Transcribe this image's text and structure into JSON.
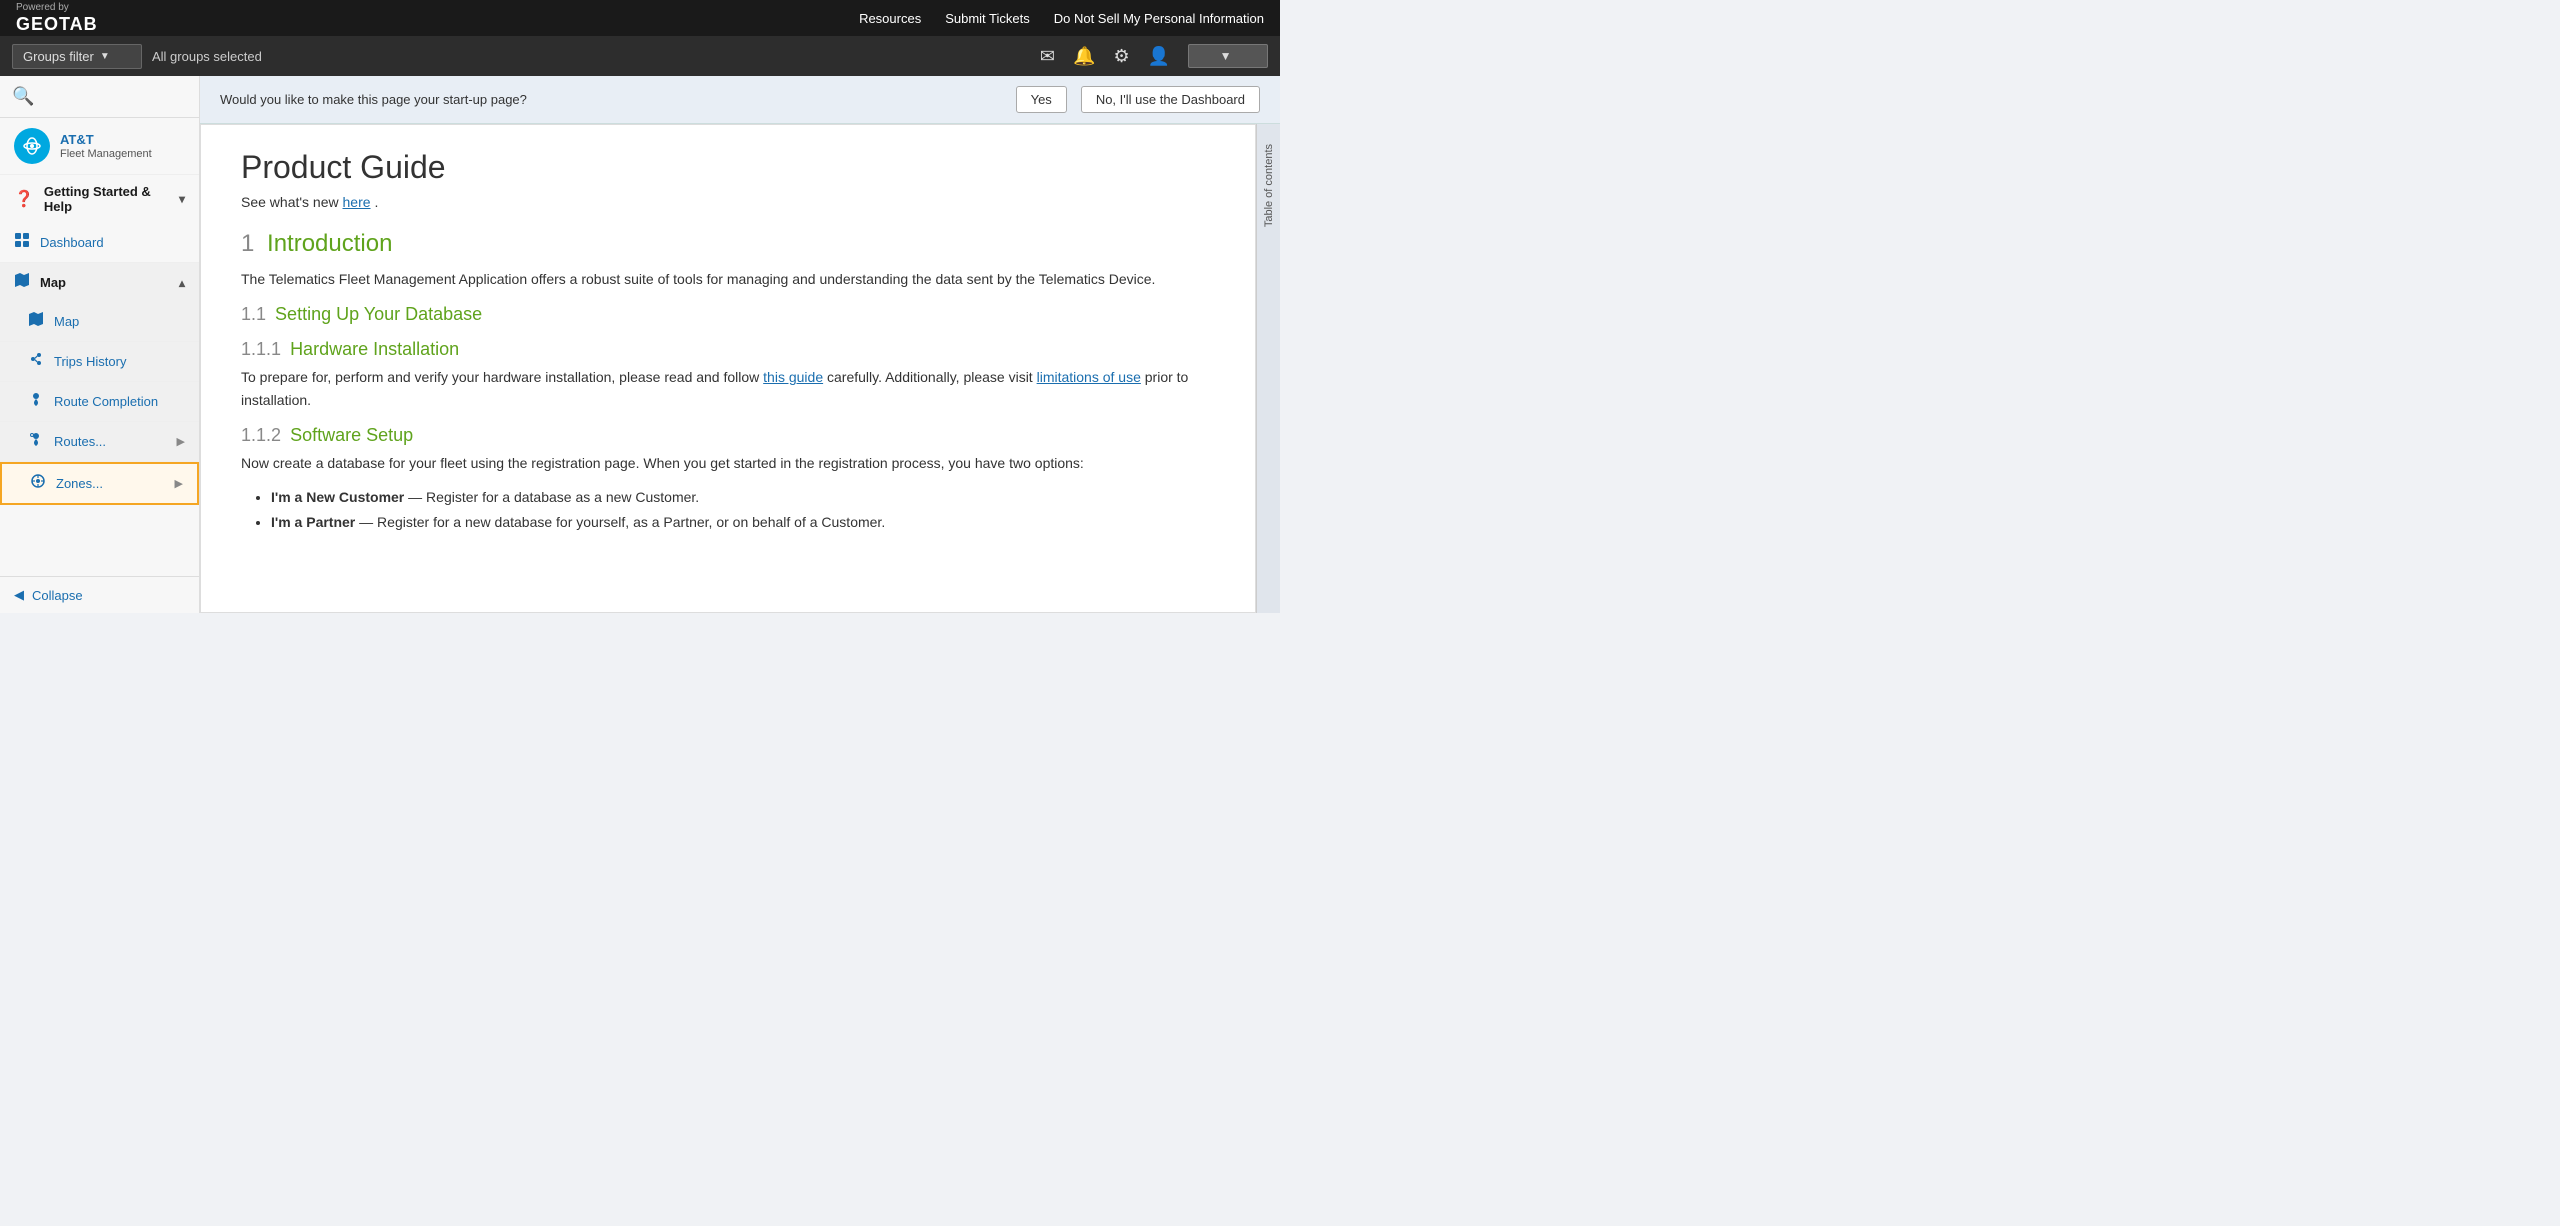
{
  "topBar": {
    "poweredBy": "Powered by",
    "brand": "GEOTAB",
    "links": [
      "Resources",
      "Submit Tickets",
      "Do Not Sell My Personal Information"
    ]
  },
  "filterBar": {
    "groupsFilterLabel": "Groups filter",
    "allGroupsSelected": "All groups selected",
    "icons": [
      "envelope-icon",
      "bell-icon",
      "gear-icon",
      "user-icon"
    ],
    "userDropdown": ""
  },
  "sidebar": {
    "searchIcon": "🔍",
    "org": {
      "logo": "AT&T",
      "name": "AT&T",
      "sub": "Fleet Management"
    },
    "gettingStarted": {
      "label": "Getting Started & Help",
      "expanded": true
    },
    "items": [
      {
        "icon": "📊",
        "label": "Dashboard",
        "active": false
      },
      {
        "icon": "🗺",
        "label": "Map",
        "expandable": true,
        "expanded": true
      },
      {
        "icon": "🗺",
        "label": "Map",
        "sub": true,
        "active": false
      },
      {
        "icon": "👣",
        "label": "Trips History",
        "sub": true,
        "active": false
      },
      {
        "icon": "📍",
        "label": "Route Completion",
        "sub": true,
        "active": false
      },
      {
        "icon": "📍",
        "label": "Routes...",
        "sub": true,
        "hasArrow": true
      },
      {
        "icon": "⚙",
        "label": "Zones...",
        "sub": true,
        "hasArrow": true,
        "highlighted": true
      }
    ],
    "collapseLabel": "Collapse"
  },
  "startupBanner": {
    "question": "Would you like to make this page your start-up page?",
    "yesLabel": "Yes",
    "noLabel": "No, I'll use the Dashboard"
  },
  "doc": {
    "title": "Product Guide",
    "subtitlePrefix": "See what's new ",
    "subtitleLink": "here",
    "subtitleSuffix": ".",
    "sections": [
      {
        "num": "1",
        "heading": "Introduction",
        "body": "The Telematics Fleet Management Application offers a robust suite of tools for managing and understanding the data sent by the Telematics Device.",
        "subsections": [
          {
            "num": "1.1",
            "heading": "Setting Up Your Database",
            "sub2": [
              {
                "num": "1.1.1",
                "heading": "Hardware Installation",
                "body": "To prepare for, perform and verify your hardware installation, please read and follow ",
                "link": "this guide",
                "bodyAfter": " carefully. Additionally, please visit ",
                "link2": "limitations of use",
                "bodyAfter2": " prior to installation."
              },
              {
                "num": "1.1.2",
                "heading": "Software Setup",
                "body": "Now create a database for your fleet using the registration page. When you get started in the registration process, you have two options:",
                "list": [
                  {
                    "bold": "I'm a New Customer",
                    "text": " — Register for a database as a new Customer."
                  },
                  {
                    "bold": "I'm a Partner",
                    "text": " — Register for a new database for yourself, as a Partner, or on behalf of a Customer."
                  }
                ]
              }
            ]
          }
        ]
      }
    ],
    "toc": "Table of contents"
  }
}
